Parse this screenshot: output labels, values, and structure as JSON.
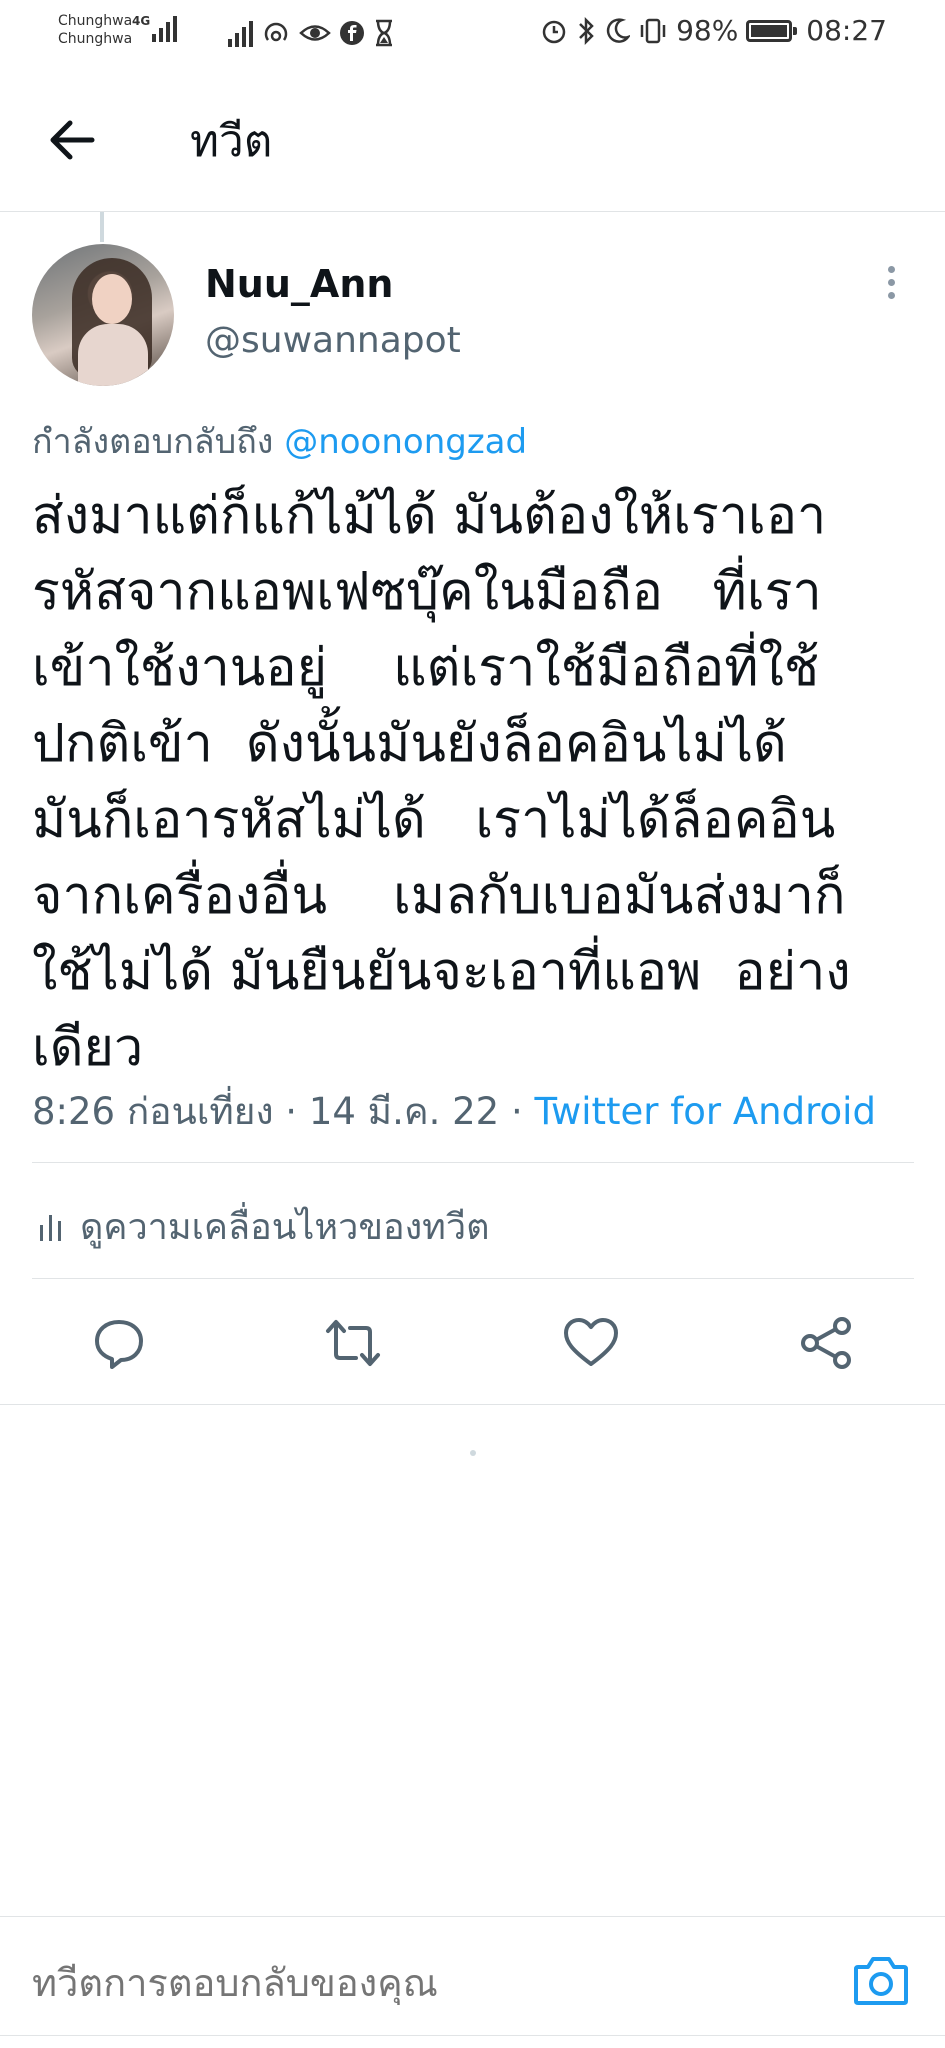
{
  "status_bar": {
    "carrier_1": "Chunghwa",
    "carrier_2": "Chunghwa",
    "network": "4G",
    "battery": "98%",
    "time": "08:27"
  },
  "header": {
    "title": "ทวีต"
  },
  "tweet": {
    "display_name": "Nuu_Ann",
    "handle": "@suwannapot",
    "reply_prefix": "กำลังตอบกลับถึง ",
    "reply_mention": "@noonongzad",
    "text": "ส่งมาแต่ก็แก้ไม้ได้ มันต้องให้เราเอา\nรหัสจากแอพเฟซบุ๊คในมือถือ   ที่เรา\nเข้าใช้งานอยู่    แต่เราใช้มือถือที่ใช้\nปกติเข้า  ดังนั้นมันยังล็อคอินไม่ได้\nมันก็เอารหัสไม่ได้   เราไม่ได้ล็อคอิน\nจากเครื่องอื่น    เมลกับเบอมันส่งมาก็\nใช้ไม่ได้ มันยืนยันจะเอาที่แอพ  อย่าง\nเดียว",
    "timestamp": "8:26 ก่อนเที่ยง · 14 มี.ค. 22 · ",
    "source": "Twitter for Android",
    "activity_label": "ดูความเคลื่อนไหวของทวีต"
  },
  "actions": {
    "reply_icon": "reply-icon",
    "retweet_icon": "retweet-icon",
    "like_icon": "heart-icon",
    "share_icon": "share-icon"
  },
  "composer": {
    "placeholder": "ทวีตการตอบกลับของคุณ"
  },
  "colors": {
    "accent": "#1d9bf0",
    "text": "#0f1419",
    "secondary": "#536471",
    "divider": "#e1e4e6"
  }
}
